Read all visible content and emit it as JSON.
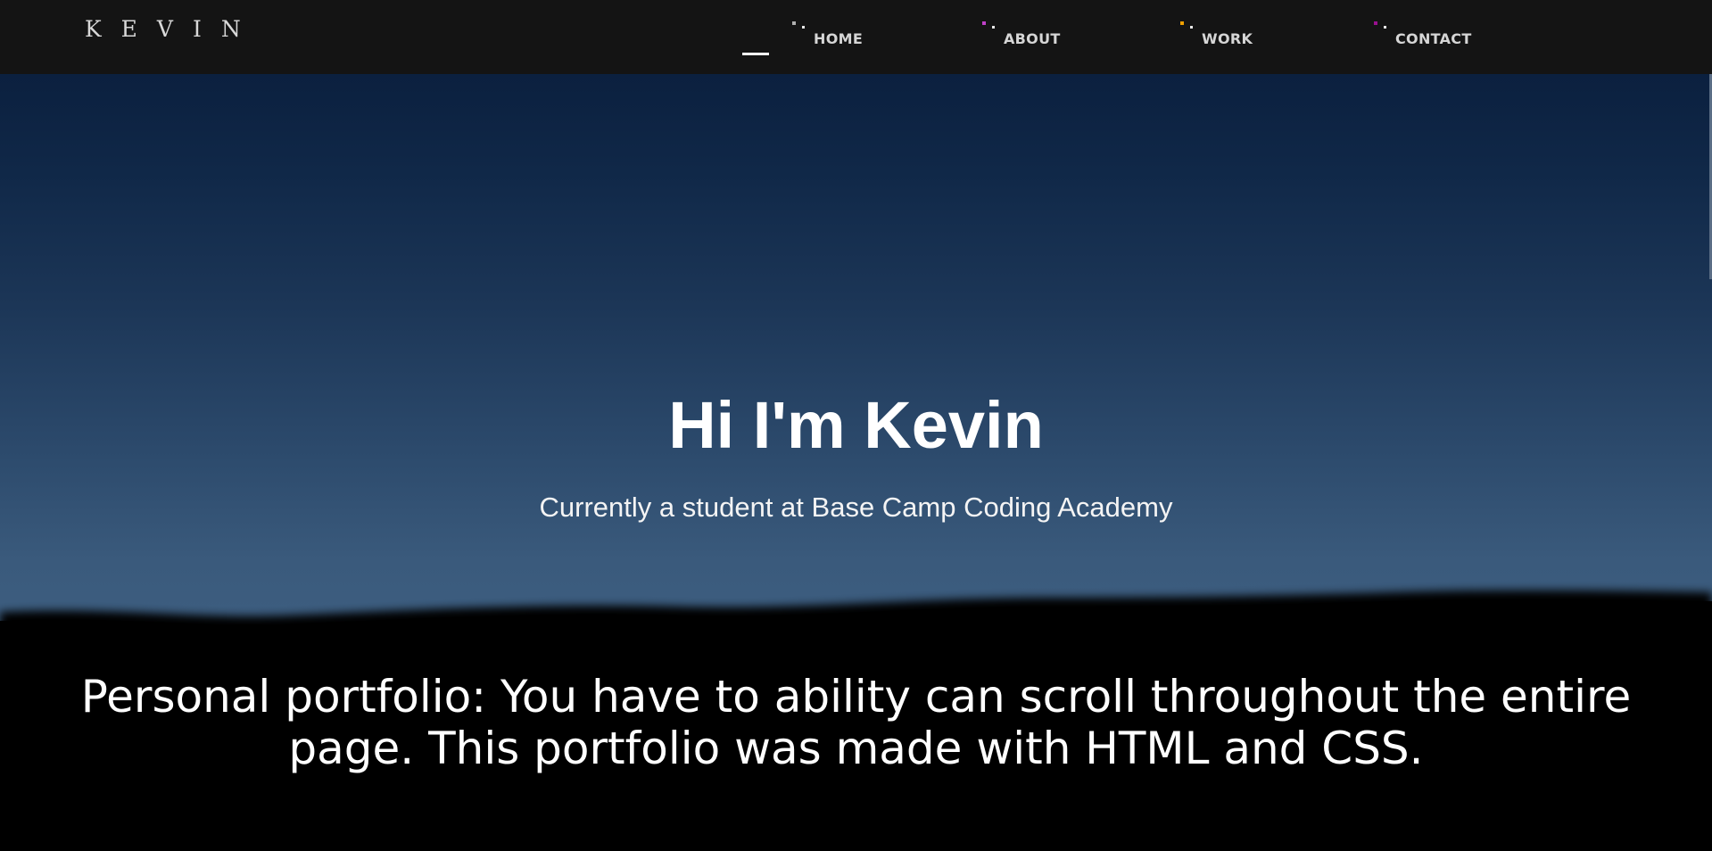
{
  "nav": {
    "brand": "KEVIN",
    "items": [
      {
        "label": "HOME",
        "dot_color": "#b0b0b0"
      },
      {
        "label": "ABOUT",
        "dot_color": "#c040c8"
      },
      {
        "label": "WORK",
        "dot_color": "#f0a000"
      },
      {
        "label": "CONTACT",
        "dot_color": "#9a1090"
      }
    ],
    "active_item": "HOME"
  },
  "hero": {
    "title": "Hi I'm Kevin",
    "subtitle": "Currently a student at Base Camp Coding Academy"
  },
  "about": {
    "description": "Personal portfolio: You have to ability can scroll throughout the entire page. This portfolio was made with HTML and CSS."
  },
  "colors": {
    "navbar_bg": "#141414",
    "sky_top": "#0b203f",
    "sky_bottom": "#3d5e80",
    "ground": "#000000",
    "text": "#ffffff"
  }
}
